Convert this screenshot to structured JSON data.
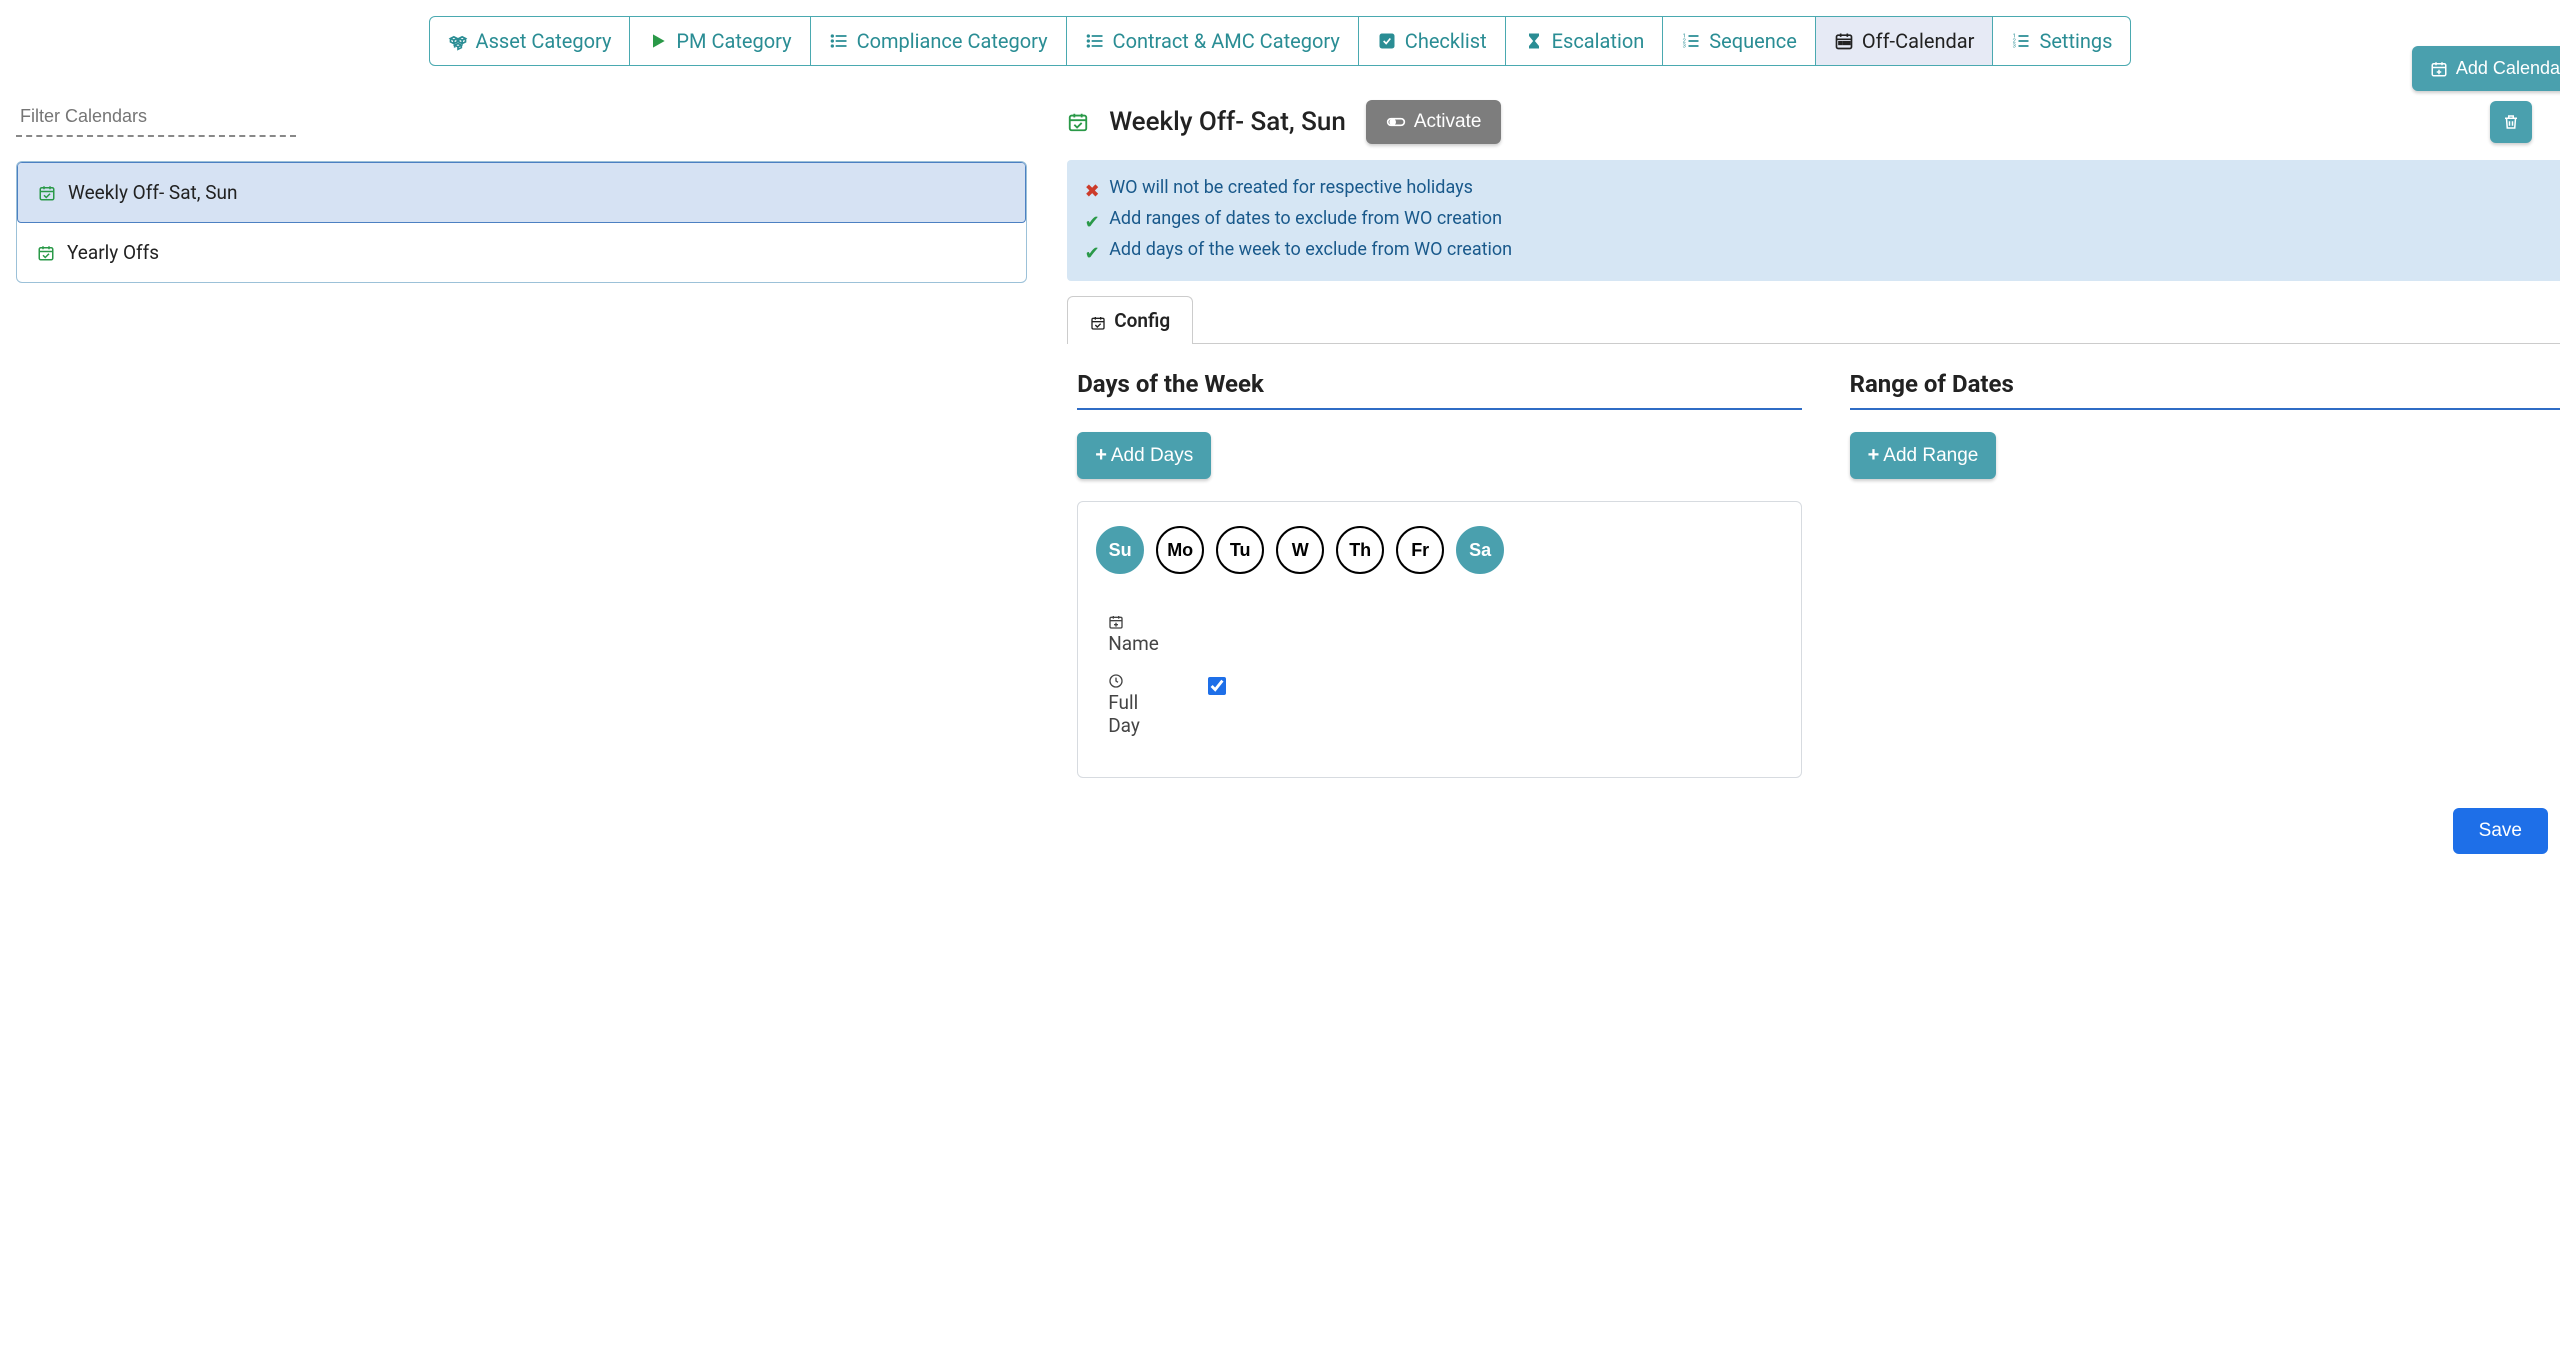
{
  "tabs": [
    {
      "label": "Asset Category"
    },
    {
      "label": "PM Category"
    },
    {
      "label": "Compliance Category"
    },
    {
      "label": "Contract & AMC Category"
    },
    {
      "label": "Checklist"
    },
    {
      "label": "Escalation"
    },
    {
      "label": "Sequence"
    },
    {
      "label": "Off-Calendar"
    },
    {
      "label": "Settings"
    }
  ],
  "filter": {
    "placeholder": "Filter Calendars"
  },
  "add_calendar_label": "Add Calendar",
  "calendars": [
    {
      "label": "Weekly Off- Sat, Sun"
    },
    {
      "label": "Yearly Offs"
    }
  ],
  "detail": {
    "title": "Weekly Off- Sat, Sun",
    "activate_label": "Activate",
    "info": [
      {
        "kind": "x",
        "text": "WO will not be created for respective holidays"
      },
      {
        "kind": "check",
        "text": "Add ranges of dates to exclude from WO creation"
      },
      {
        "kind": "check",
        "text": "Add days of the week to exclude from WO creation"
      }
    ],
    "config_tab_label": "Config",
    "days_section_title": "Days of the Week",
    "range_section_title": "Range of Dates",
    "add_days_label": "Add Days",
    "add_range_label": "Add Range",
    "days": [
      {
        "abbr": "Su",
        "selected": true
      },
      {
        "abbr": "Mo",
        "selected": false
      },
      {
        "abbr": "Tu",
        "selected": false
      },
      {
        "abbr": "W",
        "selected": false
      },
      {
        "abbr": "Th",
        "selected": false
      },
      {
        "abbr": "Fr",
        "selected": false
      },
      {
        "abbr": "Sa",
        "selected": true
      }
    ],
    "name_label": "Name",
    "full_day_label": "Full Day",
    "full_day_checked": true,
    "save_label": "Save"
  }
}
